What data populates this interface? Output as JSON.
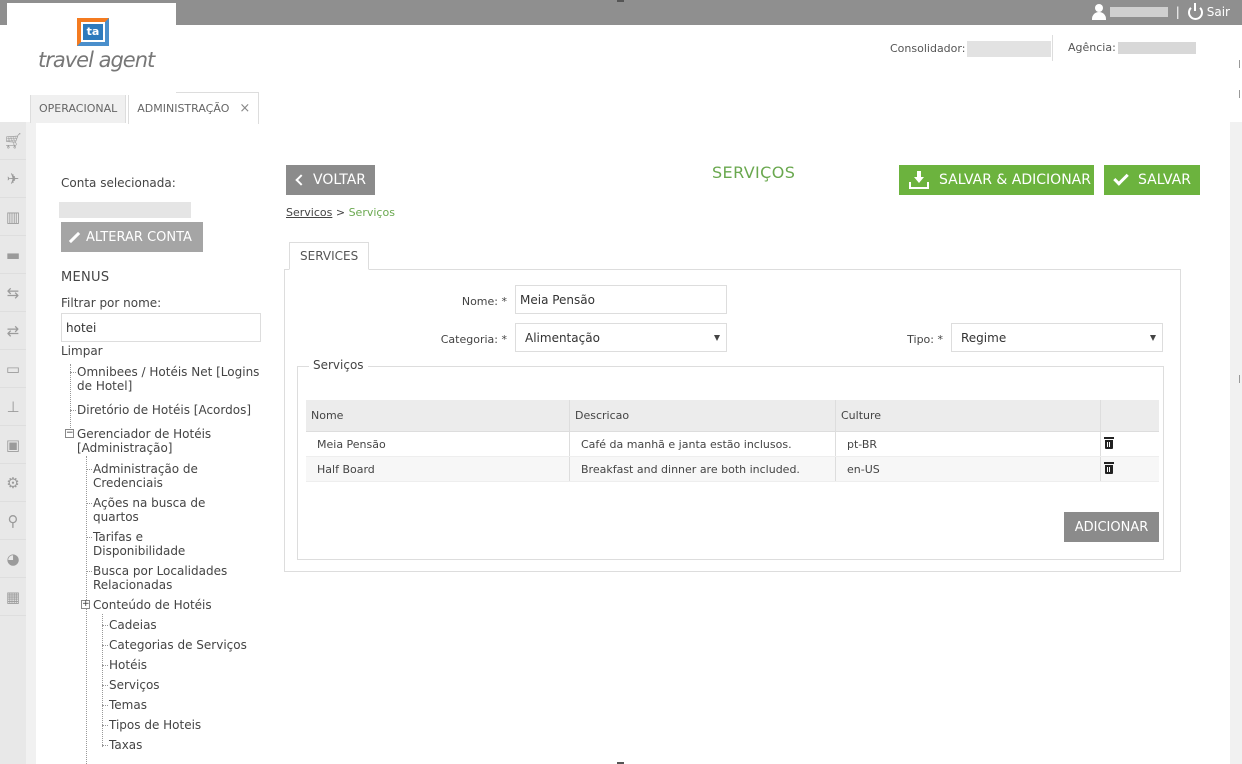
{
  "topbar": {
    "logout_label": "Sair",
    "separator": "|"
  },
  "brand": {
    "mark": "ta",
    "name": "travel agent"
  },
  "header": {
    "consolidador_label": "Consolidador:",
    "agencia_label": "Agência:"
  },
  "tabs": [
    {
      "label": "OPERACIONAL"
    },
    {
      "label": "ADMINISTRAÇÃO",
      "close": "×"
    }
  ],
  "sidebar": {
    "conta_label": "Conta selecionada:",
    "alterar_label": "ALTERAR CONTA",
    "menus_title": "MENUS",
    "filter_label": "Filtrar por nome:",
    "filter_value": "hotei",
    "clear_label": "Limpar",
    "tree": {
      "omnibees": "Omnibees / Hotéis Net [Logins de Hotel]",
      "diretorio": "Diretório de Hotéis [Acordos]",
      "gerenciador": "Gerenciador de Hotéis [Administração]",
      "admin_credenciais": "Administração de Credenciais",
      "acoes_busca": "Ações na busca de quartos",
      "tarifas": "Tarifas e Disponibilidade",
      "busca_localidades": "Busca por Localidades Relacionadas",
      "conteudo": "Conteúdo de Hotéis",
      "cadeias": "Cadeias",
      "categorias": "Categorias de Serviços",
      "hoteis": "Hotéis",
      "servicos": "Serviços",
      "temas": "Temas",
      "tipos": "Tipos de Hoteis",
      "taxas": "Taxas",
      "collapse": "−",
      "expand": "+"
    }
  },
  "main": {
    "back_label": "VOLTAR",
    "title": "SERVIÇOS",
    "save_add_label": "SALVAR & ADICIONAR",
    "save_label": "SALVAR",
    "breadcrumb": {
      "link": "Servicos",
      "sep": ">",
      "current": "Serviços"
    },
    "subtab": "SERVICES",
    "form": {
      "nome_label": "Nome: *",
      "nome_value": "Meia Pensão",
      "categoria_label": "Categoria: *",
      "categoria_value": "Alimentação",
      "tipo_label": "Tipo: *",
      "tipo_value": "Regime"
    },
    "services": {
      "legend": "Serviços",
      "columns": [
        "Nome",
        "Descricao",
        "Culture"
      ],
      "rows": [
        {
          "nome": "Meia Pensão",
          "descricao": "Café da manhã e janta estão inclusos.",
          "culture": "pt-BR"
        },
        {
          "nome": "Half Board",
          "descricao": "Breakfast and dinner are both included.",
          "culture": "en-US"
        }
      ],
      "add_label": "ADICIONAR"
    }
  },
  "colors": {
    "accent_green": "#6cb33e",
    "title_green": "#6aa84f",
    "gray_button": "#8b8b8b",
    "topbar": "#8f8f8f"
  }
}
